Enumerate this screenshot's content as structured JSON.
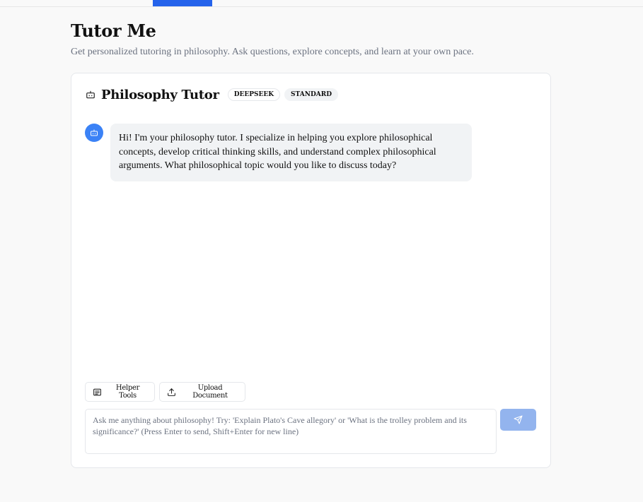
{
  "header": {
    "title": "Tutor Me",
    "subtitle": "Get personalized tutoring in philosophy. Ask questions, explore concepts, and learn at your own pace."
  },
  "tutor": {
    "title": "Philosophy Tutor",
    "badges": [
      "DEEPSEEK",
      "STANDARD"
    ],
    "icon": "bot-icon"
  },
  "messages": [
    {
      "role": "assistant",
      "text": "Hi! I'm your philosophy tutor. I specialize in helping you explore philosophical concepts, develop critical thinking skills, and understand complex philosophical arguments. What philosophical topic would you like to discuss today?"
    }
  ],
  "tools": {
    "helper_label": "Helper Tools",
    "helper_icon": "list-icon",
    "upload_label": "Upload Document",
    "upload_icon": "upload-icon"
  },
  "input": {
    "value": "",
    "placeholder": "Ask me anything about philosophy! Try: 'Explain Plato's Cave allegory' or 'What is the trolley problem and its significance?' (Press Enter to send, Shift+Enter for new line)"
  },
  "send_icon": "send-icon",
  "colors": {
    "accent": "#2563eb",
    "avatar": "#3b82f6",
    "send_button": "#93b4ee",
    "bubble": "#f1f3f5",
    "muted_text": "#6b7280"
  }
}
